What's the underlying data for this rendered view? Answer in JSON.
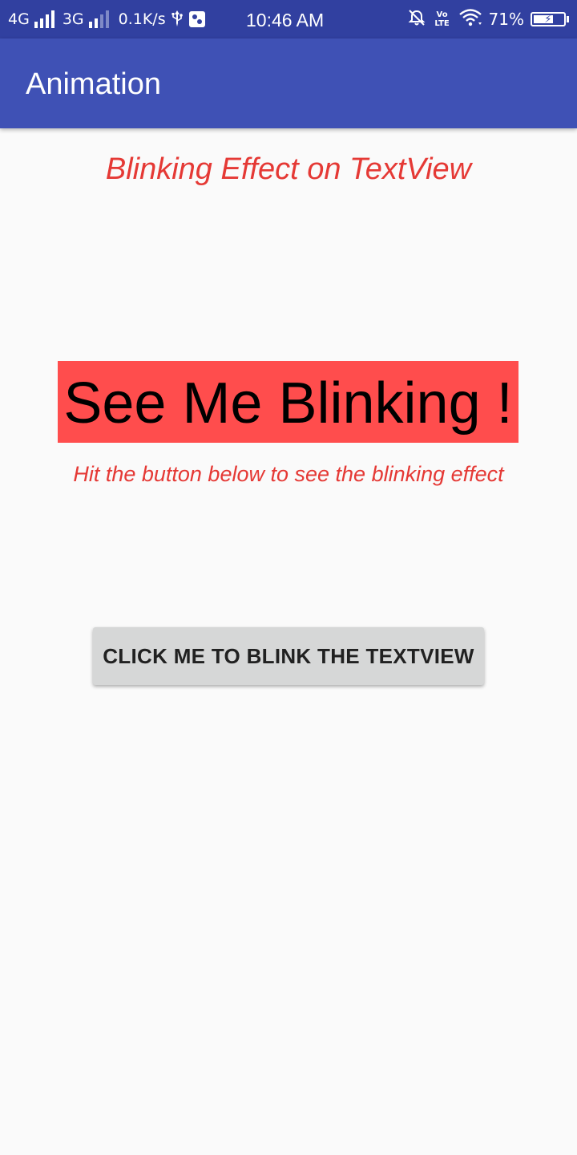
{
  "status_bar": {
    "net1": "4G",
    "net2": "3G",
    "speed": "0.1K/s",
    "time": "10:46 AM",
    "volte": "Vo LTE",
    "battery_percent": "71%",
    "battery_level": 0.71,
    "icons": [
      "signal-icon",
      "usb-icon",
      "app-notification-icon",
      "alarm-off-icon",
      "volte-icon",
      "wifi-icon",
      "battery-icon"
    ]
  },
  "app_bar": {
    "title": "Animation"
  },
  "main": {
    "heading": "Blinking Effect on TextView",
    "blink_text": "See Me Blinking !",
    "hint": "Hit the button below to see the blinking effect",
    "button_label": "CLICK ME TO BLINK THE TEXTVIEW"
  },
  "colors": {
    "status_bar": "#3140a0",
    "app_bar": "#3f51b5",
    "accent_red": "#e53935",
    "blink_background": "#ff4d4d",
    "button_background": "#d6d7d7",
    "page_background": "#fafafa"
  }
}
